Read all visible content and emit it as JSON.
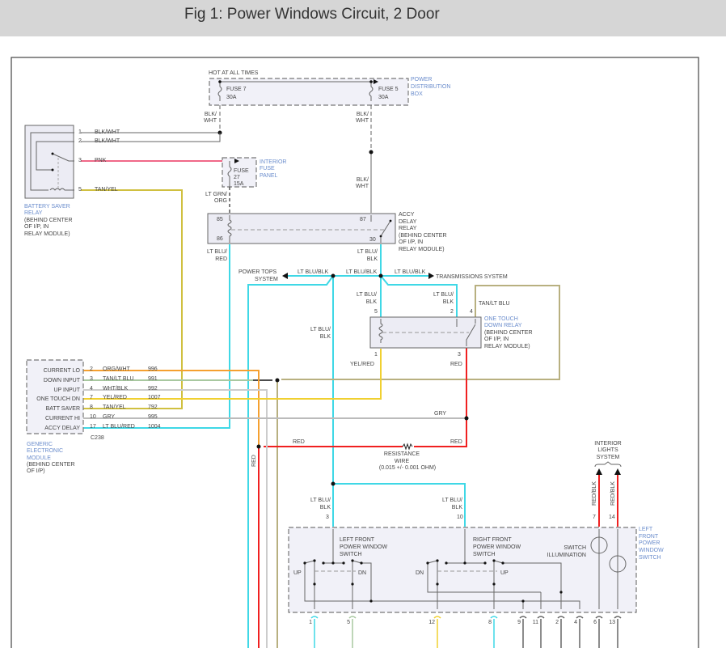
{
  "title": "Fig 1: Power Windows Circuit, 2 Door",
  "pdb": {
    "hot": "HOT AT ALL TIMES",
    "fuse7": [
      "FUSE 7",
      "30A"
    ],
    "fuse5": [
      "FUSE 5",
      "30A"
    ],
    "name": [
      "POWER",
      "DISTRIBUTION",
      "BOX"
    ],
    "wire7": [
      "BLK/",
      "WHT"
    ],
    "wire5a": [
      "BLK/",
      "WHT"
    ],
    "wire5b": [
      "BLK/",
      "WHT"
    ]
  },
  "bsr": {
    "pins": [
      "1",
      "2",
      "3",
      "5"
    ],
    "wires": [
      "BLK/WHT",
      "BLK/WHT",
      "PNK",
      "TAN/YEL"
    ],
    "name": [
      "BATTERY SAVER",
      "RELAY"
    ],
    "loc": [
      "(BEHIND CENTER",
      "OF I/P, IN",
      "RELAY MODULE)"
    ]
  },
  "ifp": {
    "fuse": [
      "FUSE",
      "27",
      "15A"
    ],
    "name": [
      "INTERIOR",
      "FUSE",
      "PANEL"
    ],
    "wire": [
      "LT GRN/",
      "ORG"
    ]
  },
  "adr": {
    "pins": [
      "85",
      "86",
      "87",
      "30"
    ],
    "name": [
      "ACCY",
      "DELAY",
      "RELAY"
    ],
    "loc": [
      "(BEHIND CENTER",
      "OF I/P, IN",
      "RELAY MODULE)"
    ],
    "wire86": [
      "LT BLU/",
      "RED"
    ],
    "wire30": [
      "LT BLU/",
      "BLK"
    ]
  },
  "bus": {
    "left": "POWER TOPS",
    "left2": "SYSTEM",
    "right": "TRANSMISSIONS SYSTEM",
    "labels": [
      "LT BLU/BLK",
      "LT BLU/BLK",
      "LT BLU/BLK"
    ]
  },
  "otr": {
    "pins": [
      "5",
      "2",
      "4",
      "1",
      "3"
    ],
    "w5": [
      "LT BLU/",
      "BLK"
    ],
    "w2": [
      "LT BLU/",
      "BLK"
    ],
    "w4": "TAN/LT BLU",
    "w1": "YEL/RED",
    "w3": "RED",
    "name": [
      "ONE TOUCH",
      "DOWN RELAY"
    ],
    "loc": [
      "(BEHIND CENTER",
      "OF I/P, IN",
      "RELAY MODULE)"
    ]
  },
  "gem": {
    "rows": [
      {
        "label": "CURRENT LO",
        "pin": "2",
        "wire": "ORG/WHT",
        "circuit": "996"
      },
      {
        "label": "DOWN INPUT",
        "pin": "3",
        "wire": "TAN/LT BLU",
        "circuit": "991"
      },
      {
        "label": "UP INPUT",
        "pin": "4",
        "wire": "WHT/BLK",
        "circuit": "992"
      },
      {
        "label": "ONE TOUCH DN",
        "pin": "7",
        "wire": "YEL/RED",
        "circuit": "1007"
      },
      {
        "label": "BATT SAVER",
        "pin": "8",
        "wire": "TAN/YEL",
        "circuit": "792"
      },
      {
        "label": "CURRENT HI",
        "pin": "10",
        "wire": "GRY",
        "circuit": "995"
      },
      {
        "label": "ACCY DELAY",
        "pin": "17",
        "wire": "LT BLU/RED",
        "circuit": "1004"
      }
    ],
    "connector": "C238",
    "name": [
      "GENERIC",
      "ELECTRONIC",
      "MODULE"
    ],
    "loc": [
      "(BEHIND CENTER",
      "OF I/P)"
    ]
  },
  "misc": {
    "gry": "GRY",
    "red1": "RED",
    "red2": "RED",
    "redv": "RED",
    "res": [
      "RESISTANCE",
      "WIRE",
      "(0.015 +/- 0.001 OHM)"
    ],
    "vleft": [
      "LT BLU/",
      "BLK"
    ]
  },
  "lfs": {
    "name": [
      "LEFT",
      "FRONT",
      "POWER",
      "WINDOW",
      "SWITCH"
    ],
    "lf": [
      "LEFT FRONT",
      "POWER WINDOW",
      "SWITCH"
    ],
    "rf": [
      "RIGHT FRONT",
      "POWER WINDOW",
      "SWITCH"
    ],
    "up1": "UP",
    "dn1": "DN",
    "dn2": "DN",
    "up2": "UP",
    "illum": [
      "SWITCH",
      "ILLUMINATION"
    ],
    "top": [
      {
        "pin": "3",
        "wire": [
          "LT BLU/",
          "BLK"
        ]
      },
      {
        "pin": "10",
        "wire": [
          "LT BLU/",
          "BLK"
        ]
      },
      {
        "pin": "7",
        "wire": "RED/BLK"
      },
      {
        "pin": "14",
        "wire": "RED/BLK"
      }
    ],
    "bottom": [
      "1",
      "5",
      "12",
      "8",
      "9",
      "11",
      "2",
      "4",
      "6",
      "13"
    ]
  },
  "ils": [
    "INTERIOR",
    "LIGHTS",
    "SYSTEM"
  ],
  "colors": {
    "cyan": "#3fd8e6",
    "red": "#f02020",
    "orange": "#f5a030",
    "pink": "#f06888",
    "yellow": "#f0d030",
    "tanyel": "#d0c040",
    "gray": "#bbbbbb",
    "tan": "#b8b080"
  }
}
